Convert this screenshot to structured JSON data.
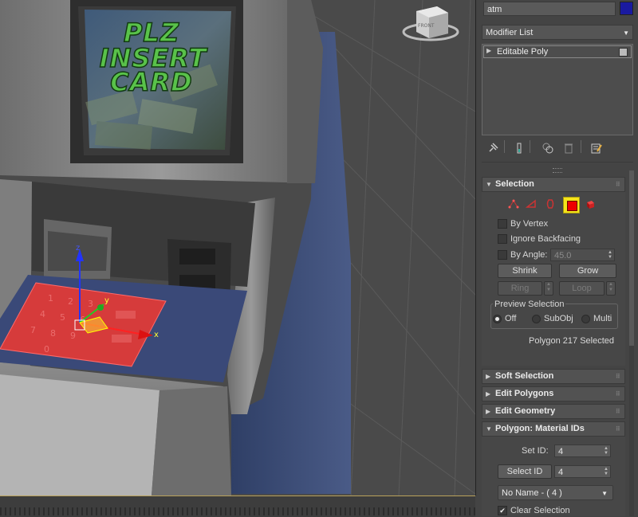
{
  "viewport": {
    "screen_text": [
      "PLZ",
      "INSERT",
      "CARD"
    ],
    "viewcube_label": "FRONT",
    "gizmo": {
      "x_label": "x",
      "y_label": "y",
      "z_label": "z"
    }
  },
  "panel": {
    "object_name": "atm",
    "object_color": "#1a1aa0",
    "modifier_list_label": "Modifier List",
    "stack_items": [
      {
        "label": "Editable Poly"
      }
    ],
    "toolbar_icons": [
      "pin-stack-icon",
      "show-end-result-icon",
      "make-unique-icon",
      "remove-modifier-icon",
      "configure-modifier-sets-icon"
    ],
    "selection": {
      "title": "Selection",
      "subobject_modes": [
        "vertex",
        "edge",
        "border",
        "polygon",
        "element"
      ],
      "active_mode": "polygon",
      "by_vertex": "By Vertex",
      "ignore_backfacing": "Ignore Backfacing",
      "by_angle": "By Angle:",
      "angle_value": "45.0",
      "shrink": "Shrink",
      "grow": "Grow",
      "ring": "Ring",
      "loop": "Loop",
      "preview_title": "Preview Selection",
      "preview_options": [
        "Off",
        "SubObj",
        "Multi"
      ],
      "preview_selected": "Off",
      "status": "Polygon 217 Selected"
    },
    "rollouts": {
      "soft_selection": "Soft Selection",
      "edit_polygons": "Edit Polygons",
      "edit_geometry": "Edit Geometry"
    },
    "material_ids": {
      "title": "Polygon: Material IDs",
      "set_id_label": "Set ID:",
      "set_id_value": "4",
      "select_id_button": "Select ID",
      "select_id_value": "4",
      "name_dropdown": "No Name - ( 4 )",
      "clear_selection": "Clear Selection",
      "clear_selection_checked": true
    }
  }
}
